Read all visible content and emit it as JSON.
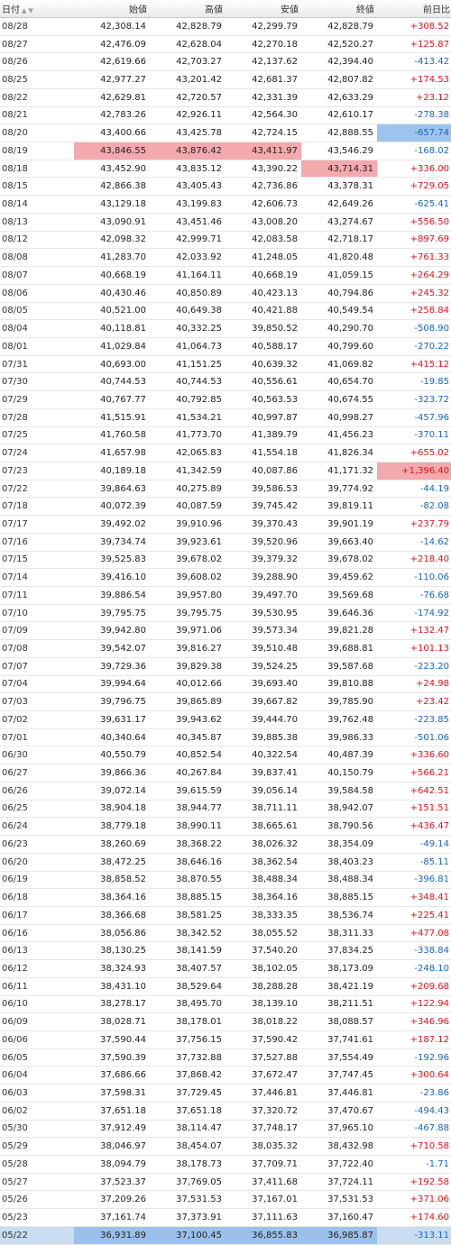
{
  "header": {
    "date": "日付",
    "open": "始値",
    "high": "高値",
    "low": "安値",
    "close": "終値",
    "change": "前日比"
  },
  "colors": {
    "up": "#e3111c",
    "down": "#1565c0",
    "highlight_up": "#f4a9ad",
    "highlight_down": "#9cc4ee"
  },
  "rows": [
    {
      "date": "08/28",
      "open": "42,308.14",
      "high": "42,828.79",
      "low": "42,299.79",
      "close": "42,828.79",
      "change": "+308.52"
    },
    {
      "date": "08/27",
      "open": "42,476.09",
      "high": "42,628.04",
      "low": "42,270.18",
      "close": "42,520.27",
      "change": "+125.87"
    },
    {
      "date": "08/26",
      "open": "42,619.66",
      "high": "42,703.27",
      "low": "42,137.62",
      "close": "42,394.40",
      "change": "-413.42"
    },
    {
      "date": "08/25",
      "open": "42,977.27",
      "high": "43,201.42",
      "low": "42,681.37",
      "close": "42,807.82",
      "change": "+174.53"
    },
    {
      "date": "08/22",
      "open": "42,629.81",
      "high": "42,720.57",
      "low": "42,331.39",
      "close": "42,633.29",
      "change": "+23.12"
    },
    {
      "date": "08/21",
      "open": "42,783.26",
      "high": "42,926.11",
      "low": "42,564.30",
      "close": "42,610.17",
      "change": "-278.38"
    },
    {
      "date": "08/20",
      "open": "43,400.66",
      "high": "43,425.78",
      "low": "42,724.15",
      "close": "42,888.55",
      "change": "-657.74",
      "hl": [
        "change"
      ]
    },
    {
      "date": "08/19",
      "open": "43,846.55",
      "high": "43,876.42",
      "low": "43,411.97",
      "close": "43,546.29",
      "change": "-168.02",
      "hl": [
        "open",
        "high",
        "low"
      ]
    },
    {
      "date": "08/18",
      "open": "43,452.90",
      "high": "43,835.12",
      "low": "43,390.22",
      "close": "43,714.31",
      "change": "+336.00",
      "hl": [
        "close"
      ]
    },
    {
      "date": "08/15",
      "open": "42,866.38",
      "high": "43,405.43",
      "low": "42,736.86",
      "close": "43,378.31",
      "change": "+729.05"
    },
    {
      "date": "08/14",
      "open": "43,129.18",
      "high": "43,199.83",
      "low": "42,606.73",
      "close": "42,649.26",
      "change": "-625.41"
    },
    {
      "date": "08/13",
      "open": "43,090.91",
      "high": "43,451.46",
      "low": "43,008.20",
      "close": "43,274.67",
      "change": "+556.50"
    },
    {
      "date": "08/12",
      "open": "42,098.32",
      "high": "42,999.71",
      "low": "42,083.58",
      "close": "42,718.17",
      "change": "+897.69"
    },
    {
      "date": "08/08",
      "open": "41,283.70",
      "high": "42,033.92",
      "low": "41,248.05",
      "close": "41,820.48",
      "change": "+761.33"
    },
    {
      "date": "08/07",
      "open": "40,668.19",
      "high": "41,164.11",
      "low": "40,668.19",
      "close": "41,059.15",
      "change": "+264.29"
    },
    {
      "date": "08/06",
      "open": "40,430.46",
      "high": "40,850.89",
      "low": "40,423.13",
      "close": "40,794.86",
      "change": "+245.32"
    },
    {
      "date": "08/05",
      "open": "40,521.00",
      "high": "40,649.38",
      "low": "40,421.88",
      "close": "40,549.54",
      "change": "+258.84"
    },
    {
      "date": "08/04",
      "open": "40,118.81",
      "high": "40,332.25",
      "low": "39,850.52",
      "close": "40,290.70",
      "change": "-508.90"
    },
    {
      "date": "08/01",
      "open": "41,029.84",
      "high": "41,064.73",
      "low": "40,588.17",
      "close": "40,799.60",
      "change": "-270.22"
    },
    {
      "date": "07/31",
      "open": "40,693.00",
      "high": "41,151.25",
      "low": "40,639.32",
      "close": "41,069.82",
      "change": "+415.12"
    },
    {
      "date": "07/30",
      "open": "40,744.53",
      "high": "40,744.53",
      "low": "40,556.61",
      "close": "40,654.70",
      "change": "-19.85"
    },
    {
      "date": "07/29",
      "open": "40,767.77",
      "high": "40,792.85",
      "low": "40,563.53",
      "close": "40,674.55",
      "change": "-323.72"
    },
    {
      "date": "07/28",
      "open": "41,515.91",
      "high": "41,534.21",
      "low": "40,997.87",
      "close": "40,998.27",
      "change": "-457.96"
    },
    {
      "date": "07/25",
      "open": "41,760.58",
      "high": "41,773.70",
      "low": "41,389.79",
      "close": "41,456.23",
      "change": "-370.11"
    },
    {
      "date": "07/24",
      "open": "41,657.98",
      "high": "42,065.83",
      "low": "41,554.18",
      "close": "41,826.34",
      "change": "+655.02"
    },
    {
      "date": "07/23",
      "open": "40,189.18",
      "high": "41,342.59",
      "low": "40,087.86",
      "close": "41,171.32",
      "change": "+1,396.40",
      "hl": [
        "change"
      ]
    },
    {
      "date": "07/22",
      "open": "39,864.63",
      "high": "40,275.89",
      "low": "39,586.53",
      "close": "39,774.92",
      "change": "-44.19"
    },
    {
      "date": "07/18",
      "open": "40,072.39",
      "high": "40,087.59",
      "low": "39,745.42",
      "close": "39,819.11",
      "change": "-82.08"
    },
    {
      "date": "07/17",
      "open": "39,492.02",
      "high": "39,910.96",
      "low": "39,370.43",
      "close": "39,901.19",
      "change": "+237.79"
    },
    {
      "date": "07/16",
      "open": "39,734.74",
      "high": "39,923.61",
      "low": "39,520.96",
      "close": "39,663.40",
      "change": "-14.62"
    },
    {
      "date": "07/15",
      "open": "39,525.83",
      "high": "39,678.02",
      "low": "39,379.32",
      "close": "39,678.02",
      "change": "+218.40"
    },
    {
      "date": "07/14",
      "open": "39,416.10",
      "high": "39,608.02",
      "low": "39,288.90",
      "close": "39,459.62",
      "change": "-110.06"
    },
    {
      "date": "07/11",
      "open": "39,886.54",
      "high": "39,957.80",
      "low": "39,497.70",
      "close": "39,569.68",
      "change": "-76.68"
    },
    {
      "date": "07/10",
      "open": "39,795.75",
      "high": "39,795.75",
      "low": "39,530.95",
      "close": "39,646.36",
      "change": "-174.92"
    },
    {
      "date": "07/09",
      "open": "39,942.80",
      "high": "39,971.06",
      "low": "39,573.34",
      "close": "39,821.28",
      "change": "+132.47"
    },
    {
      "date": "07/08",
      "open": "39,542.07",
      "high": "39,816.27",
      "low": "39,510.48",
      "close": "39,688.81",
      "change": "+101.13"
    },
    {
      "date": "07/07",
      "open": "39,729.36",
      "high": "39,829.38",
      "low": "39,524.25",
      "close": "39,587.68",
      "change": "-223.20"
    },
    {
      "date": "07/04",
      "open": "39,994.64",
      "high": "40,012.66",
      "low": "39,693.40",
      "close": "39,810.88",
      "change": "+24.98"
    },
    {
      "date": "07/03",
      "open": "39,796.75",
      "high": "39,865.89",
      "low": "39,667.82",
      "close": "39,785.90",
      "change": "+23.42"
    },
    {
      "date": "07/02",
      "open": "39,631.17",
      "high": "39,943.62",
      "low": "39,444.70",
      "close": "39,762.48",
      "change": "-223.85"
    },
    {
      "date": "07/01",
      "open": "40,340.64",
      "high": "40,345.87",
      "low": "39,885.38",
      "close": "39,986.33",
      "change": "-501.06"
    },
    {
      "date": "06/30",
      "open": "40,550.79",
      "high": "40,852.54",
      "low": "40,322.54",
      "close": "40,487.39",
      "change": "+336.60"
    },
    {
      "date": "06/27",
      "open": "39,866.36",
      "high": "40,267.84",
      "low": "39,837.41",
      "close": "40,150.79",
      "change": "+566.21"
    },
    {
      "date": "06/26",
      "open": "39,072.14",
      "high": "39,615.59",
      "low": "39,056.14",
      "close": "39,584.58",
      "change": "+642.51"
    },
    {
      "date": "06/25",
      "open": "38,904.18",
      "high": "38,944.77",
      "low": "38,711.11",
      "close": "38,942.07",
      "change": "+151.51"
    },
    {
      "date": "06/24",
      "open": "38,779.18",
      "high": "38,990.11",
      "low": "38,665.61",
      "close": "38,790.56",
      "change": "+436.47"
    },
    {
      "date": "06/23",
      "open": "38,260.69",
      "high": "38,368.22",
      "low": "38,026.32",
      "close": "38,354.09",
      "change": "-49.14"
    },
    {
      "date": "06/20",
      "open": "38,472.25",
      "high": "38,646.16",
      "low": "38,362.54",
      "close": "38,403.23",
      "change": "-85.11"
    },
    {
      "date": "06/19",
      "open": "38,858.52",
      "high": "38,870.55",
      "low": "38,488.34",
      "close": "38,488.34",
      "change": "-396.81"
    },
    {
      "date": "06/18",
      "open": "38,364.16",
      "high": "38,885.15",
      "low": "38,364.16",
      "close": "38,885.15",
      "change": "+348.41"
    },
    {
      "date": "06/17",
      "open": "38,366.68",
      "high": "38,581.25",
      "low": "38,333.35",
      "close": "38,536.74",
      "change": "+225.41"
    },
    {
      "date": "06/16",
      "open": "38,056.86",
      "high": "38,342.52",
      "low": "38,055.52",
      "close": "38,311.33",
      "change": "+477.08"
    },
    {
      "date": "06/13",
      "open": "38,130.25",
      "high": "38,141.59",
      "low": "37,540.20",
      "close": "37,834.25",
      "change": "-338.84"
    },
    {
      "date": "06/12",
      "open": "38,324.93",
      "high": "38,407.57",
      "low": "38,102.05",
      "close": "38,173.09",
      "change": "-248.10"
    },
    {
      "date": "06/11",
      "open": "38,431.10",
      "high": "38,529.64",
      "low": "38,288.28",
      "close": "38,421.19",
      "change": "+209.68"
    },
    {
      "date": "06/10",
      "open": "38,278.17",
      "high": "38,495.70",
      "low": "38,139.10",
      "close": "38,211.51",
      "change": "+122.94"
    },
    {
      "date": "06/09",
      "open": "38,028.71",
      "high": "38,178.01",
      "low": "38,018.22",
      "close": "38,088.57",
      "change": "+346.96"
    },
    {
      "date": "06/06",
      "open": "37,590.44",
      "high": "37,756.15",
      "low": "37,590.42",
      "close": "37,741.61",
      "change": "+187.12"
    },
    {
      "date": "06/05",
      "open": "37,590.39",
      "high": "37,732.88",
      "low": "37,527.88",
      "close": "37,554.49",
      "change": "-192.96"
    },
    {
      "date": "06/04",
      "open": "37,686.66",
      "high": "37,868.42",
      "low": "37,672.47",
      "close": "37,747.45",
      "change": "+300.64"
    },
    {
      "date": "06/03",
      "open": "37,598.31",
      "high": "37,729.45",
      "low": "37,446.81",
      "close": "37,446.81",
      "change": "-23.86"
    },
    {
      "date": "06/02",
      "open": "37,651.18",
      "high": "37,651.18",
      "low": "37,320.72",
      "close": "37,470.67",
      "change": "-494.43"
    },
    {
      "date": "05/30",
      "open": "37,912.49",
      "high": "38,114.47",
      "low": "37,748.17",
      "close": "37,965.10",
      "change": "-467.88"
    },
    {
      "date": "05/29",
      "open": "38,046.97",
      "high": "38,454.07",
      "low": "38,035.32",
      "close": "38,432.98",
      "change": "+710.58"
    },
    {
      "date": "05/28",
      "open": "38,094.79",
      "high": "38,178.73",
      "low": "37,709.71",
      "close": "37,722.40",
      "change": "-1.71"
    },
    {
      "date": "05/27",
      "open": "37,523.37",
      "high": "37,769.05",
      "low": "37,411.68",
      "close": "37,724.11",
      "change": "+192.58"
    },
    {
      "date": "05/26",
      "open": "37,209.26",
      "high": "37,531.53",
      "low": "37,167.01",
      "close": "37,531.53",
      "change": "+371.06"
    },
    {
      "date": "05/23",
      "open": "37,161.74",
      "high": "37,373.91",
      "low": "37,111.63",
      "close": "37,160.47",
      "change": "+174.60"
    },
    {
      "date": "05/22",
      "open": "36,931.89",
      "high": "37,100.45",
      "low": "36,855.83",
      "close": "36,985.87",
      "change": "-313.11",
      "hl": [
        "open",
        "high",
        "low",
        "close"
      ],
      "selected": true
    }
  ]
}
